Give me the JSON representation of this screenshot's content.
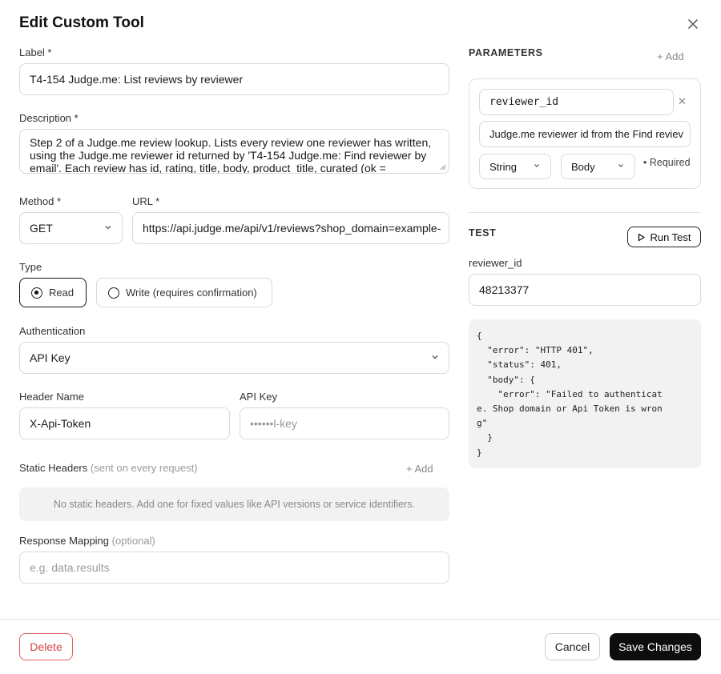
{
  "dialog": {
    "title": "Edit Custom Tool",
    "close_icon": "close-icon"
  },
  "form": {
    "label": {
      "label": "Label *",
      "value": "T4-154 Judge.me: List reviews by reviewer"
    },
    "description": {
      "label": "Description *",
      "value": "Step 2 of a Judge.me review lookup. Lists every review one reviewer has written, using the Judge.me reviewer id returned by 'T4-154 Judge.me: Find reviewer by email'. Each review has id, rating, title, body, product_title, curated (ok ="
    },
    "method": {
      "label": "Method *",
      "value": "GET",
      "options": [
        "GET"
      ]
    },
    "url": {
      "label": "URL *",
      "value": "https://api.judge.me/api/v1/reviews?shop_domain=example-"
    },
    "type": {
      "label": "Type",
      "options": [
        {
          "label": "Read",
          "selected": true
        },
        {
          "label": "Write (requires confirmation)",
          "selected": false
        }
      ]
    },
    "authentication": {
      "label": "Authentication",
      "value": "API Key"
    },
    "header_name": {
      "label": "Header Name",
      "value": "X-Api-Token"
    },
    "api_key": {
      "label": "API Key",
      "value": "••••••l-key"
    },
    "static_headers": {
      "label": "Static Headers",
      "hint": "(sent on every request)",
      "add_label": "+ Add",
      "empty_text": "No static headers. Add one for fixed values like API versions or service identifiers."
    },
    "response_mapping": {
      "label": "Response Mapping",
      "hint": "(optional)",
      "placeholder": "e.g. data.results"
    }
  },
  "parameters": {
    "heading": "PARAMETERS",
    "add_label": "+ Add",
    "items": [
      {
        "name": "reviewer_id",
        "description": "Judge.me reviewer id from the Find reviev",
        "type": "String",
        "location": "Body",
        "required_label": "• Required"
      }
    ]
  },
  "test": {
    "heading": "TEST",
    "run_label": "Run Test",
    "input_label": "reviewer_id",
    "input_value": "48213377",
    "output": "{\n  \"error\": \"HTTP 401\",\n  \"status\": 401,\n  \"body\": {\n    \"error\": \"Failed to authenticat\ne. Shop domain or Api Token is wron\ng\"\n  }\n}"
  },
  "footer": {
    "delete_label": "Delete",
    "cancel_label": "Cancel",
    "save_label": "Save Changes"
  },
  "colors": {
    "accent": "#0d0d0d",
    "danger": "#d64545",
    "muted_bg": "#f2f2f2"
  }
}
